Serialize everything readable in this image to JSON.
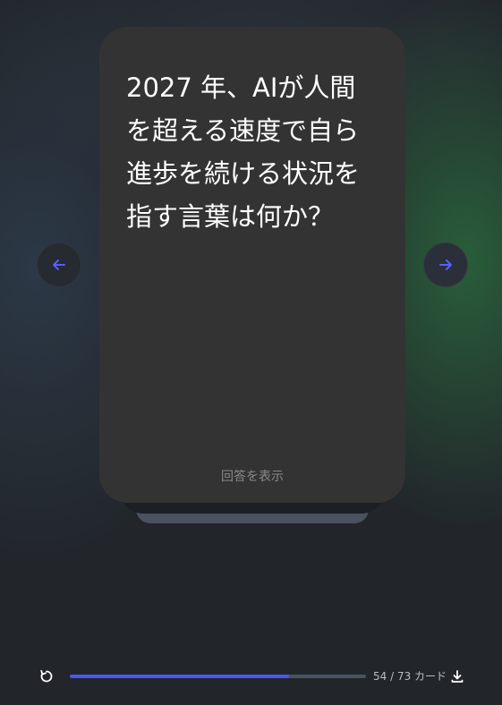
{
  "card": {
    "question": "2027 年、AIが人間を超える速度で自ら進歩を続ける状況を指す言葉は何か？",
    "reveal_label": "回答を表示"
  },
  "navigation": {
    "prev_icon": "arrow-left-icon",
    "next_icon": "arrow-right-icon",
    "accent_color": "#5560ff"
  },
  "footer": {
    "reset_icon": "restart-icon",
    "progress": {
      "current": 54,
      "total": 73,
      "fraction": 0.74
    },
    "counter_text": "54 / 73 カード",
    "download_icon": "download-icon",
    "progress_color": "#4b55f0"
  }
}
